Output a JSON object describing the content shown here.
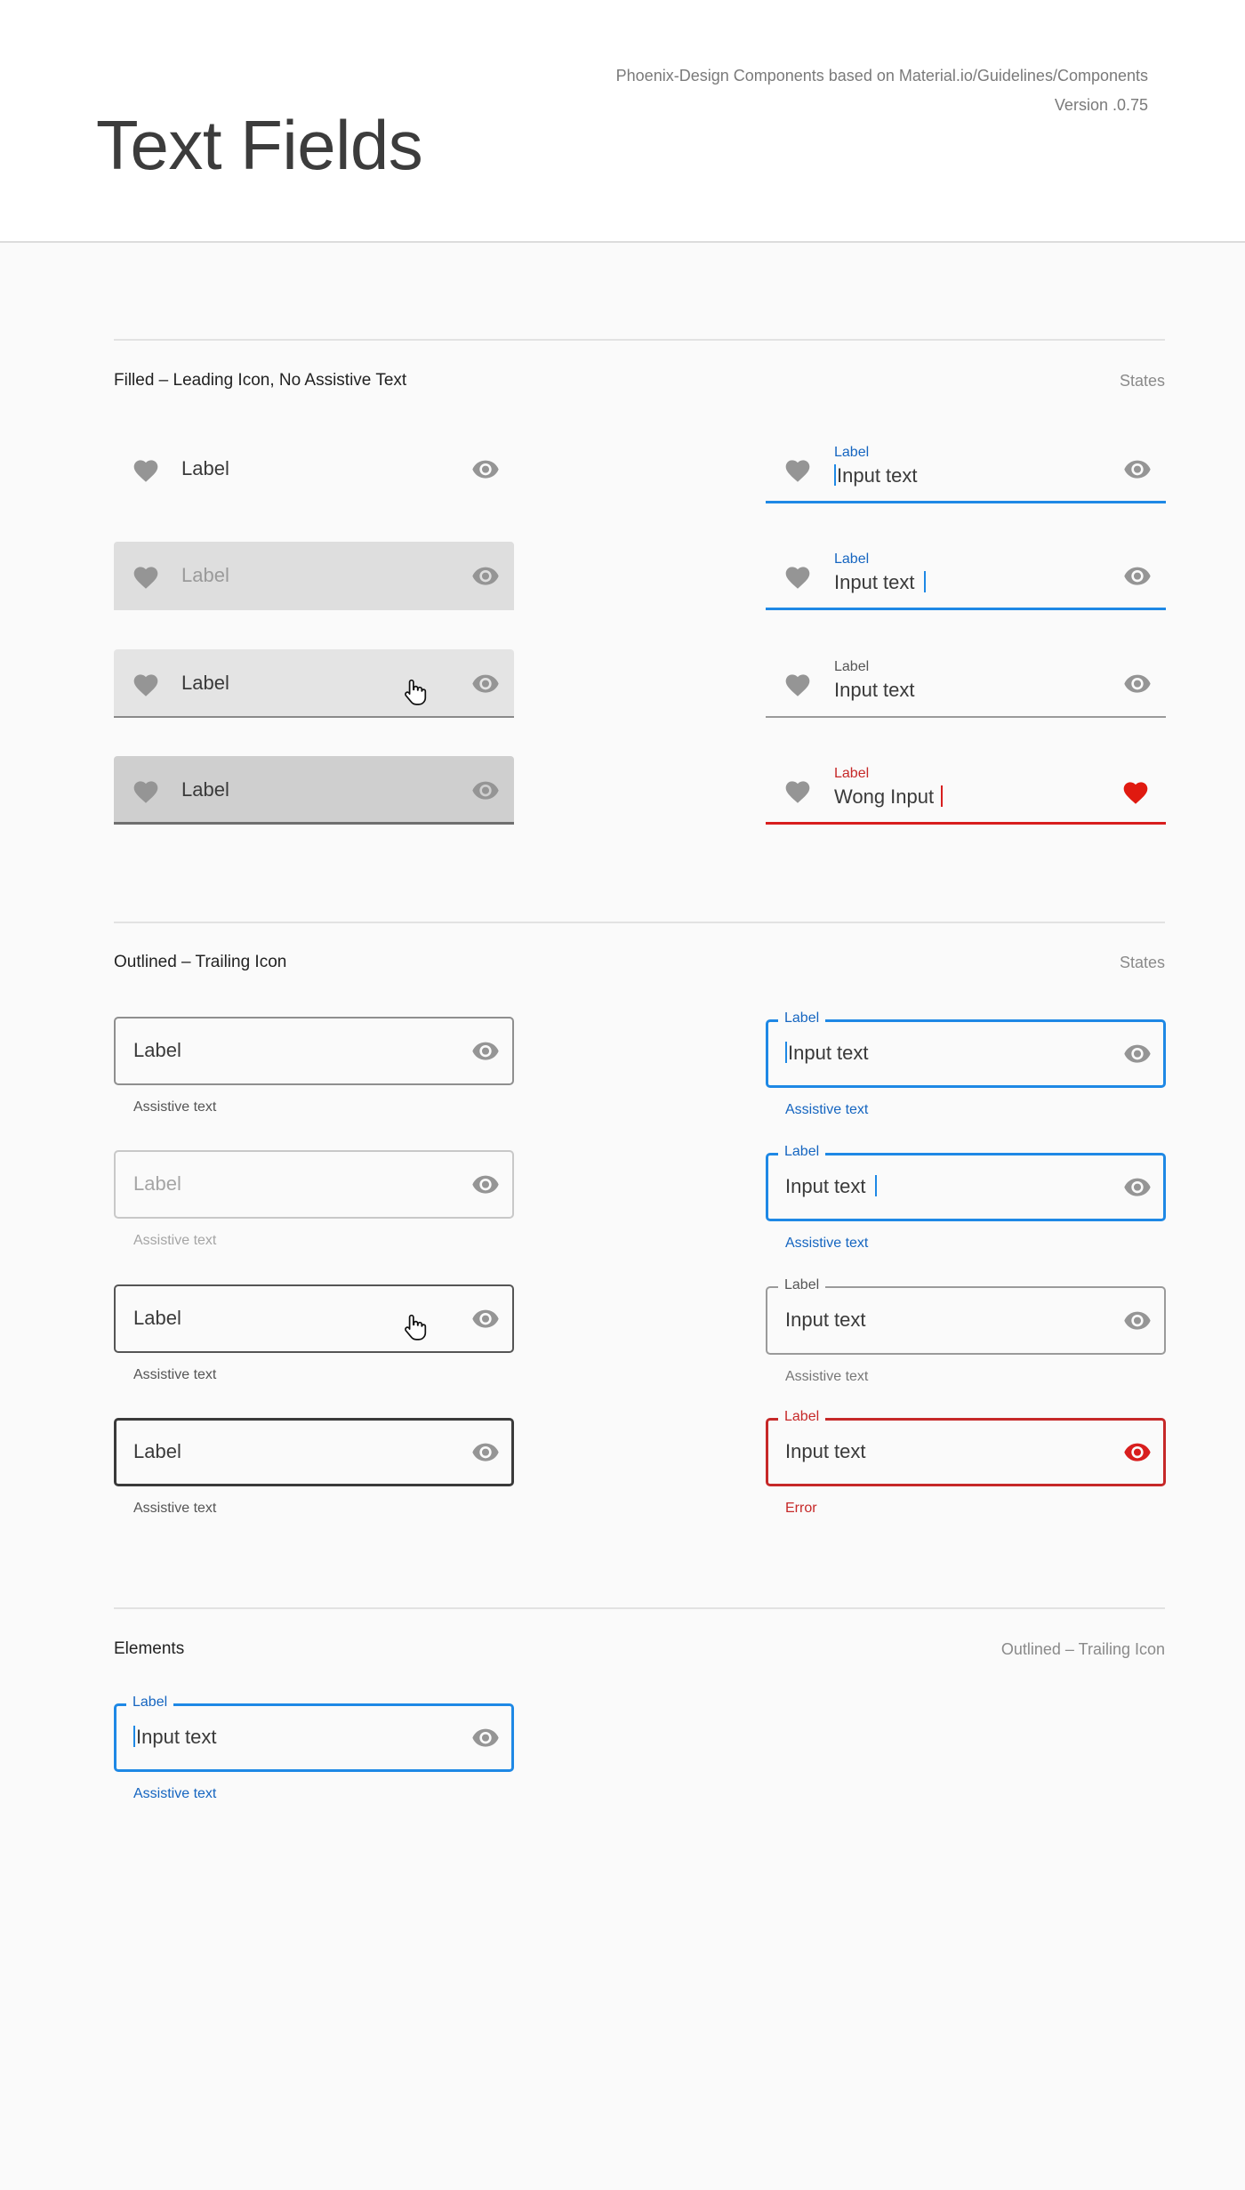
{
  "header": {
    "title": "Text Fields",
    "meta_line1": "Phoenix-Design Components based on Material.io/Guidelines/Components",
    "meta_line2": "Version .0.75"
  },
  "sections": {
    "filled": {
      "title": "Filled – Leading Icon, No Assistive Text",
      "note": "States"
    },
    "outlined": {
      "title": "Outlined – Trailing Icon",
      "note": "States"
    },
    "elements": {
      "title": "Elements",
      "note": "Outlined – Trailing Icon"
    }
  },
  "filled_left": [
    {
      "state": "enabled",
      "label": "Label"
    },
    {
      "state": "disabled",
      "label": "Label"
    },
    {
      "state": "hover",
      "label": "Label"
    },
    {
      "state": "pressed",
      "label": "Label"
    }
  ],
  "filled_right": [
    {
      "state": "focused-empty",
      "label": "Label",
      "value": "Input text"
    },
    {
      "state": "focused-typing",
      "label": "Label",
      "value": "Input text"
    },
    {
      "state": "filled",
      "label": "Label",
      "value": "Input text"
    },
    {
      "state": "error",
      "label": "Label",
      "value": "Wong Input"
    }
  ],
  "outlined_left": [
    {
      "state": "enabled",
      "label": "Label",
      "assistive": "Assistive text"
    },
    {
      "state": "disabled",
      "label": "Label",
      "assistive": "Assistive text"
    },
    {
      "state": "hover",
      "label": "Label",
      "assistive": "Assistive text"
    },
    {
      "state": "pressed",
      "label": "Label",
      "assistive": "Assistive text"
    }
  ],
  "outlined_right": [
    {
      "state": "focused-empty",
      "label": "Label",
      "value": "Input text",
      "assistive": "Assistive text"
    },
    {
      "state": "focused-typing",
      "label": "Label",
      "value": "Input text",
      "assistive": "Assistive text"
    },
    {
      "state": "filled",
      "label": "Label",
      "value": "Input text",
      "assistive": "Assistive text"
    },
    {
      "state": "error",
      "label": "Label",
      "value": "Input text",
      "assistive": "Error"
    }
  ],
  "elements_field": {
    "label": "Label",
    "value": "Input text",
    "assistive": "Assistive text"
  },
  "icons": {
    "leading": "heart-icon",
    "trailing": "eye-icon",
    "pointer": "hand-pointer-icon"
  },
  "colors": {
    "primary": "#1e88e5",
    "primary_text": "#1565c0",
    "error": "#c62828",
    "error_icon": "#d81e1e",
    "icon": "#959595",
    "text": "#3a3a3a"
  }
}
